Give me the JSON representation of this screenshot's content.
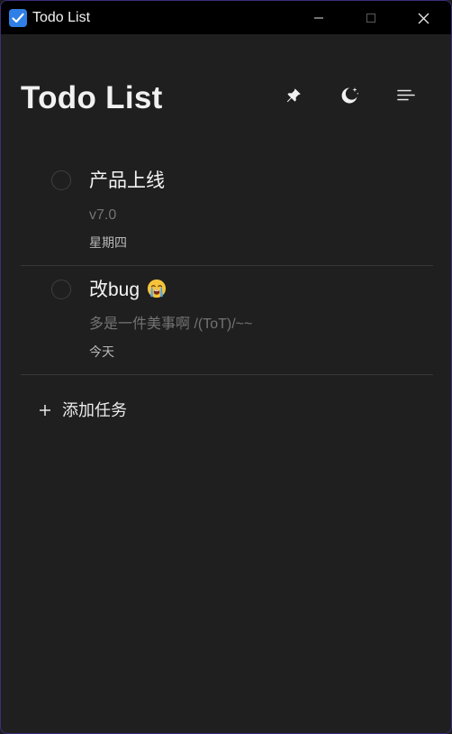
{
  "window": {
    "title": "Todo List",
    "accent": "#2f7fe6",
    "icons": {
      "app": "checkbox-icon",
      "minimize": "minimize-icon",
      "maximize": "maximize-icon",
      "close": "close-icon"
    }
  },
  "header": {
    "title": "Todo List",
    "icons": {
      "pin": "pin-icon",
      "theme": "moon-stars-icon",
      "menu": "menu-icon"
    }
  },
  "tasks": [
    {
      "title": "产品上线",
      "note": "v7.0",
      "date": "星期四",
      "completed": false
    },
    {
      "title": "改bug",
      "emoji": "crying-face-emoji",
      "note": "多是一件美事啊 /(ToT)/~~",
      "date": "今天",
      "completed": false
    }
  ],
  "add_task": {
    "label": "添加任务",
    "icon": "plus-icon"
  }
}
